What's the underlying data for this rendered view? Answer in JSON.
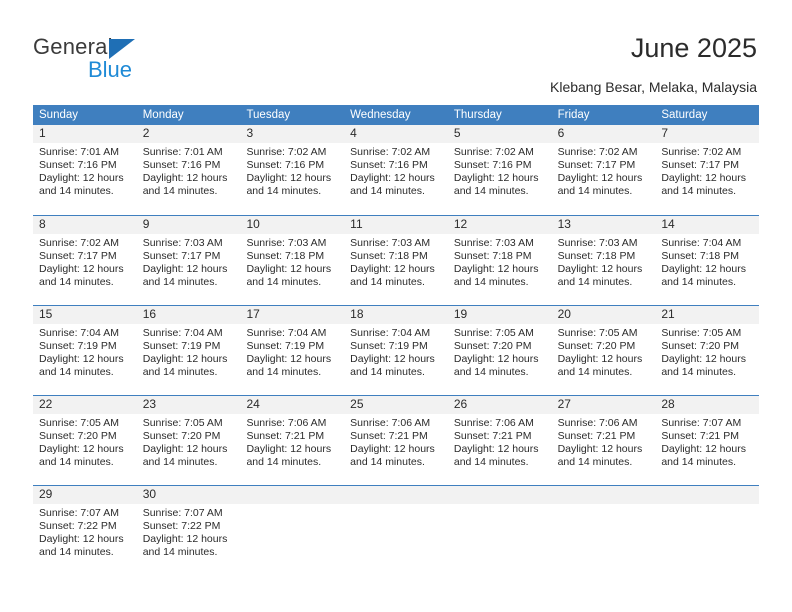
{
  "brand": {
    "line1": "General",
    "line2": "Blue",
    "triangle_icon": "triangle-icon",
    "color_dark": "#3b3b3b",
    "color_blue": "#1f8ad6",
    "triangle_color": "#1f6fb5"
  },
  "header": {
    "title": "June 2025",
    "subtitle": "Klebang Besar, Melaka, Malaysia"
  },
  "theme": {
    "header_bg": "#3f7fbf",
    "header_text": "#ffffff",
    "daynum_band_bg": "#f2f2f2",
    "row_divider": "#3f7fbf",
    "text": "#2b2b2b"
  },
  "weekdays": [
    "Sunday",
    "Monday",
    "Tuesday",
    "Wednesday",
    "Thursday",
    "Friday",
    "Saturday"
  ],
  "weeks": [
    [
      {
        "day": "1",
        "sunrise": "Sunrise: 7:01 AM",
        "sunset": "Sunset: 7:16 PM",
        "daylight": "Daylight: 12 hours and 14 minutes."
      },
      {
        "day": "2",
        "sunrise": "Sunrise: 7:01 AM",
        "sunset": "Sunset: 7:16 PM",
        "daylight": "Daylight: 12 hours and 14 minutes."
      },
      {
        "day": "3",
        "sunrise": "Sunrise: 7:02 AM",
        "sunset": "Sunset: 7:16 PM",
        "daylight": "Daylight: 12 hours and 14 minutes."
      },
      {
        "day": "4",
        "sunrise": "Sunrise: 7:02 AM",
        "sunset": "Sunset: 7:16 PM",
        "daylight": "Daylight: 12 hours and 14 minutes."
      },
      {
        "day": "5",
        "sunrise": "Sunrise: 7:02 AM",
        "sunset": "Sunset: 7:16 PM",
        "daylight": "Daylight: 12 hours and 14 minutes."
      },
      {
        "day": "6",
        "sunrise": "Sunrise: 7:02 AM",
        "sunset": "Sunset: 7:17 PM",
        "daylight": "Daylight: 12 hours and 14 minutes."
      },
      {
        "day": "7",
        "sunrise": "Sunrise: 7:02 AM",
        "sunset": "Sunset: 7:17 PM",
        "daylight": "Daylight: 12 hours and 14 minutes."
      }
    ],
    [
      {
        "day": "8",
        "sunrise": "Sunrise: 7:02 AM",
        "sunset": "Sunset: 7:17 PM",
        "daylight": "Daylight: 12 hours and 14 minutes."
      },
      {
        "day": "9",
        "sunrise": "Sunrise: 7:03 AM",
        "sunset": "Sunset: 7:17 PM",
        "daylight": "Daylight: 12 hours and 14 minutes."
      },
      {
        "day": "10",
        "sunrise": "Sunrise: 7:03 AM",
        "sunset": "Sunset: 7:18 PM",
        "daylight": "Daylight: 12 hours and 14 minutes."
      },
      {
        "day": "11",
        "sunrise": "Sunrise: 7:03 AM",
        "sunset": "Sunset: 7:18 PM",
        "daylight": "Daylight: 12 hours and 14 minutes."
      },
      {
        "day": "12",
        "sunrise": "Sunrise: 7:03 AM",
        "sunset": "Sunset: 7:18 PM",
        "daylight": "Daylight: 12 hours and 14 minutes."
      },
      {
        "day": "13",
        "sunrise": "Sunrise: 7:03 AM",
        "sunset": "Sunset: 7:18 PM",
        "daylight": "Daylight: 12 hours and 14 minutes."
      },
      {
        "day": "14",
        "sunrise": "Sunrise: 7:04 AM",
        "sunset": "Sunset: 7:18 PM",
        "daylight": "Daylight: 12 hours and 14 minutes."
      }
    ],
    [
      {
        "day": "15",
        "sunrise": "Sunrise: 7:04 AM",
        "sunset": "Sunset: 7:19 PM",
        "daylight": "Daylight: 12 hours and 14 minutes."
      },
      {
        "day": "16",
        "sunrise": "Sunrise: 7:04 AM",
        "sunset": "Sunset: 7:19 PM",
        "daylight": "Daylight: 12 hours and 14 minutes."
      },
      {
        "day": "17",
        "sunrise": "Sunrise: 7:04 AM",
        "sunset": "Sunset: 7:19 PM",
        "daylight": "Daylight: 12 hours and 14 minutes."
      },
      {
        "day": "18",
        "sunrise": "Sunrise: 7:04 AM",
        "sunset": "Sunset: 7:19 PM",
        "daylight": "Daylight: 12 hours and 14 minutes."
      },
      {
        "day": "19",
        "sunrise": "Sunrise: 7:05 AM",
        "sunset": "Sunset: 7:20 PM",
        "daylight": "Daylight: 12 hours and 14 minutes."
      },
      {
        "day": "20",
        "sunrise": "Sunrise: 7:05 AM",
        "sunset": "Sunset: 7:20 PM",
        "daylight": "Daylight: 12 hours and 14 minutes."
      },
      {
        "day": "21",
        "sunrise": "Sunrise: 7:05 AM",
        "sunset": "Sunset: 7:20 PM",
        "daylight": "Daylight: 12 hours and 14 minutes."
      }
    ],
    [
      {
        "day": "22",
        "sunrise": "Sunrise: 7:05 AM",
        "sunset": "Sunset: 7:20 PM",
        "daylight": "Daylight: 12 hours and 14 minutes."
      },
      {
        "day": "23",
        "sunrise": "Sunrise: 7:05 AM",
        "sunset": "Sunset: 7:20 PM",
        "daylight": "Daylight: 12 hours and 14 minutes."
      },
      {
        "day": "24",
        "sunrise": "Sunrise: 7:06 AM",
        "sunset": "Sunset: 7:21 PM",
        "daylight": "Daylight: 12 hours and 14 minutes."
      },
      {
        "day": "25",
        "sunrise": "Sunrise: 7:06 AM",
        "sunset": "Sunset: 7:21 PM",
        "daylight": "Daylight: 12 hours and 14 minutes."
      },
      {
        "day": "26",
        "sunrise": "Sunrise: 7:06 AM",
        "sunset": "Sunset: 7:21 PM",
        "daylight": "Daylight: 12 hours and 14 minutes."
      },
      {
        "day": "27",
        "sunrise": "Sunrise: 7:06 AM",
        "sunset": "Sunset: 7:21 PM",
        "daylight": "Daylight: 12 hours and 14 minutes."
      },
      {
        "day": "28",
        "sunrise": "Sunrise: 7:07 AM",
        "sunset": "Sunset: 7:21 PM",
        "daylight": "Daylight: 12 hours and 14 minutes."
      }
    ],
    [
      {
        "day": "29",
        "sunrise": "Sunrise: 7:07 AM",
        "sunset": "Sunset: 7:22 PM",
        "daylight": "Daylight: 12 hours and 14 minutes."
      },
      {
        "day": "30",
        "sunrise": "Sunrise: 7:07 AM",
        "sunset": "Sunset: 7:22 PM",
        "daylight": "Daylight: 12 hours and 14 minutes."
      },
      {
        "day": "",
        "sunrise": "",
        "sunset": "",
        "daylight": ""
      },
      {
        "day": "",
        "sunrise": "",
        "sunset": "",
        "daylight": ""
      },
      {
        "day": "",
        "sunrise": "",
        "sunset": "",
        "daylight": ""
      },
      {
        "day": "",
        "sunrise": "",
        "sunset": "",
        "daylight": ""
      },
      {
        "day": "",
        "sunrise": "",
        "sunset": "",
        "daylight": ""
      }
    ]
  ]
}
